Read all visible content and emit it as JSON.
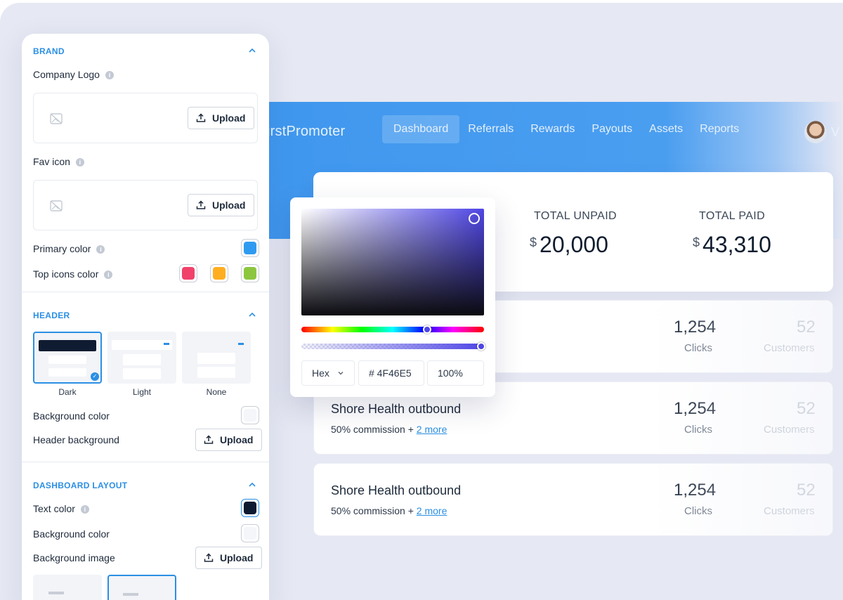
{
  "app": {
    "brand_name": "irstPromoter",
    "avatar_initial": "V"
  },
  "nav": {
    "items": [
      {
        "label": "Dashboard",
        "active": true
      },
      {
        "label": "Referrals"
      },
      {
        "label": "Rewards"
      },
      {
        "label": "Payouts"
      },
      {
        "label": "Assets"
      },
      {
        "label": "Reports"
      }
    ]
  },
  "stats": {
    "unpaid_label": "TOTAL UNPAID",
    "unpaid_currency": "$",
    "unpaid_value": "20,000",
    "paid_label": "TOTAL PAID",
    "paid_currency": "$",
    "paid_value": "43,310"
  },
  "campaigns": [
    {
      "title": "",
      "sub_prefix": "",
      "more": "",
      "clicks": "1,254",
      "clicks_label": "Clicks",
      "customers": "52",
      "customers_label": "Customers"
    },
    {
      "title": "Shore Health outbound",
      "sub_prefix": "50% commission + ",
      "more": "2 more",
      "clicks": "1,254",
      "clicks_label": "Clicks",
      "customers": "52",
      "customers_label": "Customers"
    },
    {
      "title": "Shore Health outbound",
      "sub_prefix": "50% commission + ",
      "more": "2 more",
      "clicks": "1,254",
      "clicks_label": "Clicks",
      "customers": "52",
      "customers_label": "Customers"
    }
  ],
  "picker": {
    "mode": "Hex",
    "hex": "# 4F46E5",
    "alpha": "100%",
    "color": "#4F46E5",
    "hue_position": 0.69,
    "alpha_value": 1.0
  },
  "panel": {
    "brand": {
      "heading": "BRAND",
      "company_logo_label": "Company Logo",
      "fav_icon_label": "Fav icon",
      "upload_label": "Upload",
      "primary_color_label": "Primary color",
      "primary_color": "#2F9BF0",
      "top_icons_label": "Top icons color",
      "top_icon_colors": [
        "#F0426B",
        "#FFAE22",
        "#8CC63F"
      ]
    },
    "header": {
      "heading": "HEADER",
      "options": [
        {
          "label": "Dark",
          "selected": true
        },
        {
          "label": "Light"
        },
        {
          "label": "None"
        }
      ],
      "background_color_label": "Background color",
      "header_background_label": "Header background",
      "upload_label": "Upload"
    },
    "dashboard_layout": {
      "heading": "DASHBOARD LAYOUT",
      "text_color_label": "Text color",
      "text_color": "#0D1A30",
      "background_color_label": "Background color",
      "background_image_label": "Background image",
      "upload_label": "Upload"
    }
  }
}
